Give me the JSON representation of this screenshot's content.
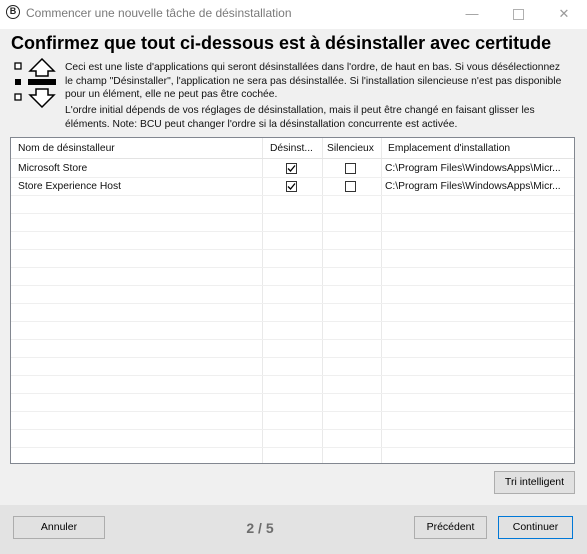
{
  "window": {
    "title": "Commencer une nouvelle tâche de désinstallation",
    "app_icon_letter": "B",
    "controls": {
      "minimize": "—",
      "close": "✕"
    }
  },
  "headline": "Confirmez que tout ci-dessous est à désinstaller avec certitude",
  "description": {
    "paragraph1": "Ceci est une liste d'applications qui seront désinstallées dans l'ordre, de haut en bas. Si vous désélectionnez le champ \"Désinstaller\", l'application ne sera pas désinstallée. Si l'installation silencieuse n'est pas disponible pour un élément, elle ne peut pas être cochée.",
    "paragraph2": "L'ordre initial dépends de vos réglages de désinstallation, mais il peut être changé en faisant glisser les éléments. Note: BCU peut changer l'ordre si la désinstallation concurrente est activée."
  },
  "table": {
    "columns": [
      "Nom de désinstalleur",
      "Désinst...",
      "Silencieux",
      "Emplacement d'installation"
    ],
    "rows": [
      {
        "name": "Microsoft Store",
        "uninstall": true,
        "quiet": false,
        "location": "C:\\Program Files\\WindowsApps\\Micr..."
      },
      {
        "name": "Store Experience Host",
        "uninstall": true,
        "quiet": false,
        "location": "C:\\Program Files\\WindowsApps\\Micr..."
      }
    ]
  },
  "buttons": {
    "smart_sort": "Tri intelligent",
    "cancel": "Annuler",
    "previous": "Précédent",
    "next": "Continuer"
  },
  "step_indicator": "2 / 5",
  "colors": {
    "accent": "#0078d7",
    "footer": "#e3e3e3",
    "background": "#f0f0f0"
  }
}
